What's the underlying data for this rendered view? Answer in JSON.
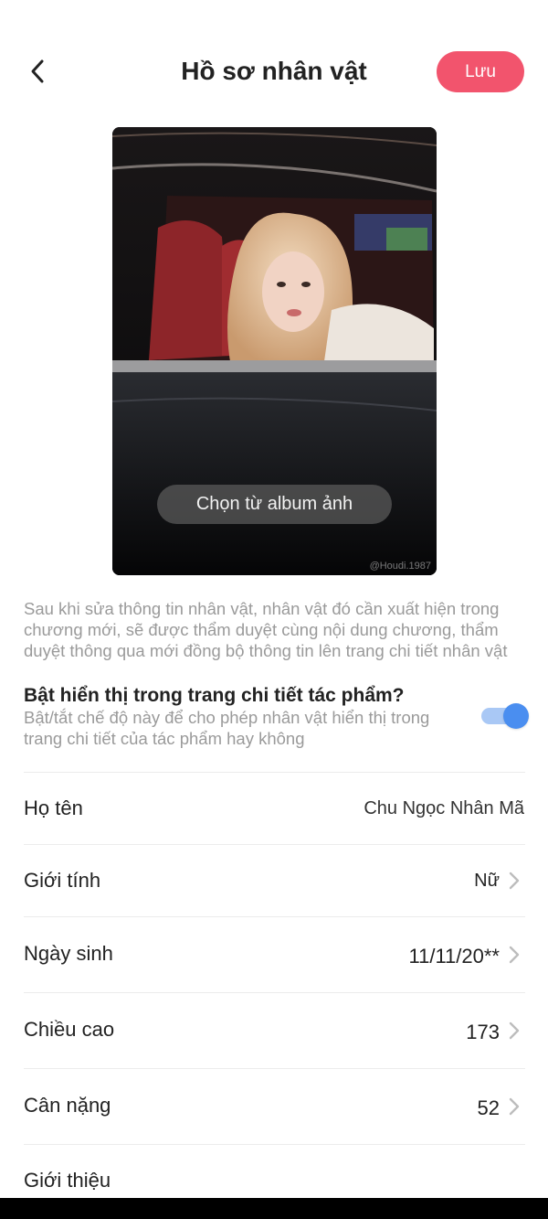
{
  "header": {
    "title": "Hồ sơ nhân vật",
    "save_label": "Lưu",
    "back_icon": "chevron-left-icon"
  },
  "photo": {
    "choose_album_label": "Chọn từ album ảnh",
    "watermark": "@Houdi.1987"
  },
  "notice": "Sau khi sửa thông tin nhân vật, nhân vật đó cần xuất hiện trong chương mới, sẽ được thẩm duyệt cùng nội dung chương, thẩm duyệt thông qua mới đồng bộ thông tin lên trang chi tiết nhân vật",
  "visibility_toggle": {
    "title": "Bật hiển thị trong trang chi tiết tác phẩm?",
    "description": "Bật/tắt chế độ này để cho phép nhân vật hiển thị trong trang chi tiết của tác phẩm hay không",
    "enabled": true,
    "color_on": "#4a8ef0"
  },
  "fields": {
    "name": {
      "label": "Họ tên",
      "value": "Chu Ngọc Nhân Mã"
    },
    "gender": {
      "label": "Giới tính",
      "value": "Nữ"
    },
    "birthday": {
      "label": "Ngày sinh",
      "value": "11/11/20**"
    },
    "height": {
      "label": "Chiều cao",
      "value": "173"
    },
    "weight": {
      "label": "Cân nặng",
      "value": "52"
    },
    "intro": {
      "label": "Giới thiệu"
    }
  },
  "colors": {
    "accent": "#f2546d",
    "muted_text": "#9a9a9a"
  }
}
